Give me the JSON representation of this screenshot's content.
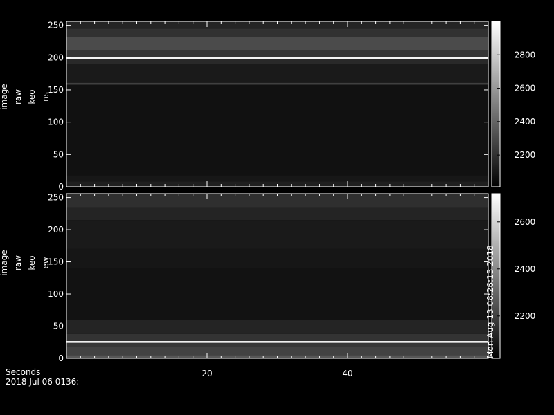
{
  "chart_data": [
    {
      "type": "heatmap",
      "ylabel": [
        "image",
        "raw",
        "keo",
        "ns"
      ],
      "ylim": [
        0,
        256
      ],
      "yticks": [
        0,
        50,
        100,
        150,
        200,
        250
      ],
      "xlim": [
        0,
        60
      ],
      "xticks": [
        20,
        40
      ],
      "colorbar": {
        "range": [
          2010,
          3000
        ],
        "ticks": [
          2200,
          2400,
          2600,
          2800
        ]
      },
      "rows": [
        {
          "y0": 0,
          "y1": 8,
          "value": 2130
        },
        {
          "y0": 8,
          "y1": 18,
          "value": 2100
        },
        {
          "y0": 18,
          "y1": 158,
          "value": 2075
        },
        {
          "y0": 158,
          "y1": 161,
          "value": 2260
        },
        {
          "y0": 161,
          "y1": 190,
          "value": 2110
        },
        {
          "y0": 190,
          "y1": 198,
          "value": 2170
        },
        {
          "y0": 198,
          "y1": 201,
          "value": 2960
        },
        {
          "y0": 201,
          "y1": 212,
          "value": 2220
        },
        {
          "y0": 212,
          "y1": 232,
          "value": 2300
        },
        {
          "y0": 232,
          "y1": 245,
          "value": 2200
        },
        {
          "y0": 245,
          "y1": 256,
          "value": 2150
        }
      ]
    },
    {
      "type": "heatmap",
      "ylabel": [
        "image",
        "raw",
        "keo",
        "ew"
      ],
      "ylim": [
        0,
        256
      ],
      "yticks": [
        0,
        50,
        100,
        150,
        200,
        250
      ],
      "xlim": [
        0,
        60
      ],
      "xticks": [
        20,
        40
      ],
      "colorbar": {
        "range": [
          2020,
          2720
        ],
        "ticks": [
          2200,
          2400,
          2600
        ]
      },
      "rows": [
        {
          "y0": 0,
          "y1": 5,
          "value": 2260
        },
        {
          "y0": 5,
          "y1": 18,
          "value": 2200
        },
        {
          "y0": 18,
          "y1": 24,
          "value": 2170
        },
        {
          "y0": 24,
          "y1": 27,
          "value": 2680
        },
        {
          "y0": 27,
          "y1": 38,
          "value": 2160
        },
        {
          "y0": 38,
          "y1": 60,
          "value": 2120
        },
        {
          "y0": 60,
          "y1": 140,
          "value": 2070
        },
        {
          "y0": 140,
          "y1": 170,
          "value": 2080
        },
        {
          "y0": 170,
          "y1": 215,
          "value": 2090
        },
        {
          "y0": 215,
          "y1": 235,
          "value": 2120
        },
        {
          "y0": 235,
          "y1": 256,
          "value": 2150
        }
      ]
    }
  ],
  "footer": {
    "xlabel": "Seconds",
    "date": "2018 Jul 06 0136:",
    "side_stamp": "Mon Aug 13 08:26:13 2018"
  },
  "colors": {
    "background": "#000000",
    "axis": "#ffffff"
  }
}
